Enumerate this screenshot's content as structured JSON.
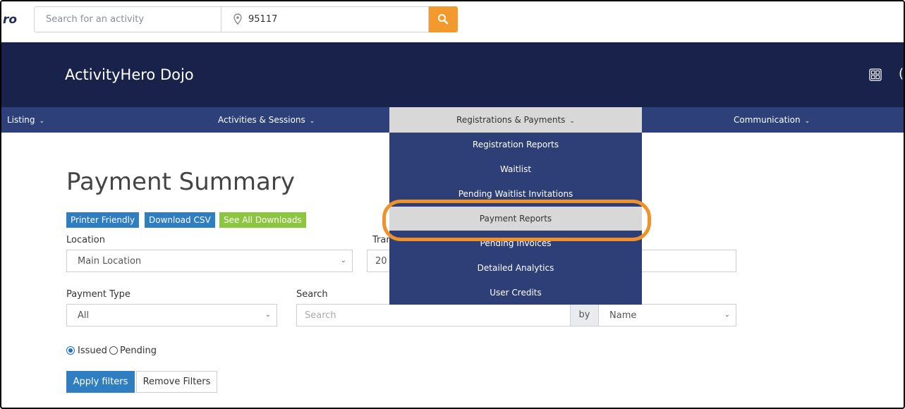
{
  "topbar": {
    "logo_text": "ro",
    "activity_placeholder": "Search for an activity",
    "zip_value": "95117",
    "icons": {
      "location": "map-pin-icon",
      "search": "magnifier-icon"
    }
  },
  "header": {
    "brand": "ActivityHero Dojo",
    "paren": "(",
    "icons": {
      "apps": "grid-icon"
    }
  },
  "nav": {
    "items": [
      {
        "label": "Listing"
      },
      {
        "label": "Activities & Sessions"
      },
      {
        "label": "Registrations & Payments"
      },
      {
        "label": "Communication"
      }
    ],
    "chevron": "⌄"
  },
  "dropdown": {
    "items": [
      {
        "label": "Registration Reports"
      },
      {
        "label": "Waitlist"
      },
      {
        "label": "Pending Waitlist Invitations"
      },
      {
        "label": "Payment Reports"
      },
      {
        "label": "Pending Invoices"
      },
      {
        "label": "Detailed Analytics"
      },
      {
        "label": "User Credits"
      }
    ],
    "selected": "Payment Reports"
  },
  "page": {
    "title": "Payment Summary",
    "buttons": {
      "printer": "Printer Friendly",
      "csv": "Download CSV",
      "downloads": "See All Downloads"
    },
    "location_label": "Location",
    "location_value": "Main Location",
    "tran_label": "Tran",
    "tran_value": "20",
    "payment_type_label": "Payment Type",
    "payment_type_value": "All",
    "search_label": "Search",
    "search_placeholder": "Search",
    "by_label": "by",
    "by_value": "Name",
    "radio_issued": "Issued",
    "radio_pending": "Pending",
    "radio_selected": "Issued",
    "apply_label": "Apply filters",
    "remove_label": "Remove Filters"
  },
  "colors": {
    "header_bg": "#18224a",
    "nav_bg": "#2e4079",
    "accent_orange": "#f29a2e",
    "btn_blue": "#2f7ec2",
    "btn_green": "#8cc63f"
  }
}
